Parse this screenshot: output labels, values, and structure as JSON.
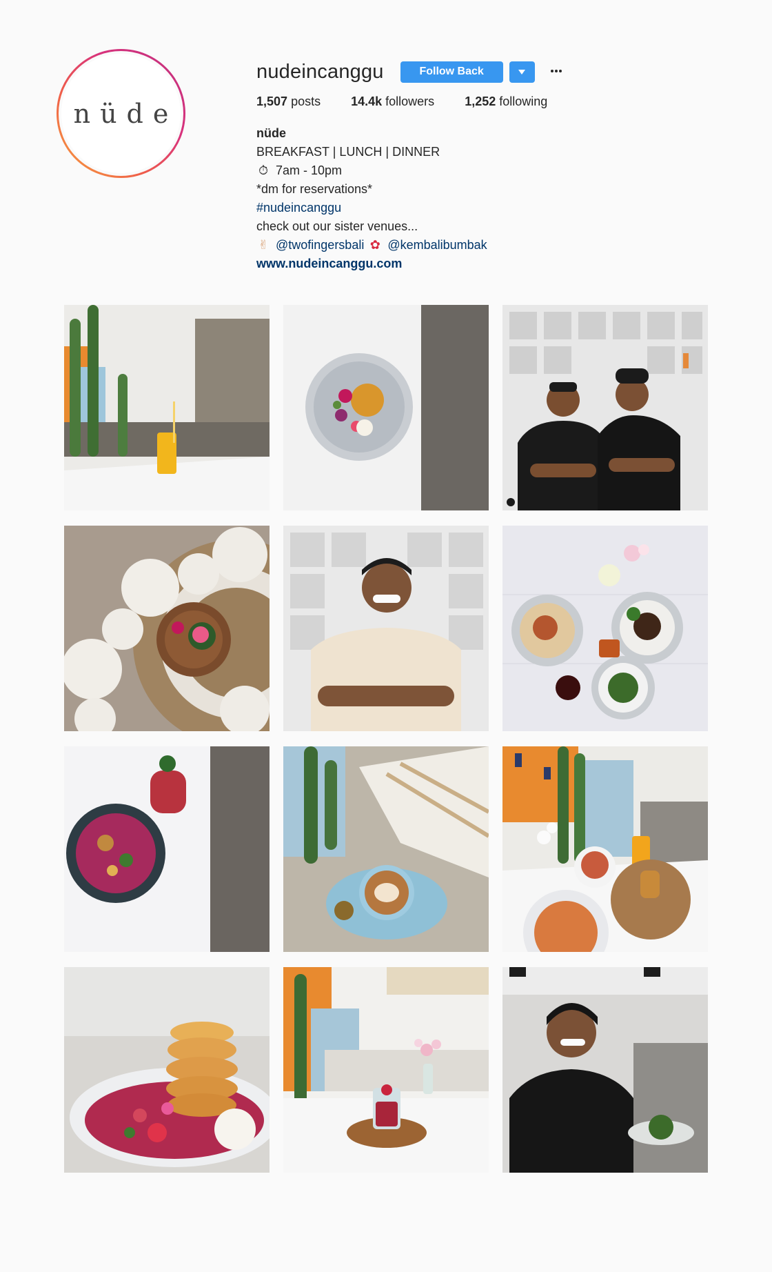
{
  "profile": {
    "avatar_logo": "nüde",
    "username": "nudeincanggu",
    "follow_back_label": "Follow Back",
    "more_icon": "more-horizontal-icon",
    "dropdown_icon": "caret-down-icon",
    "ring_colors": [
      "#f7a43c",
      "#ef5d4a",
      "#d8327c",
      "#c0307e"
    ],
    "accent_color": "#3897f0"
  },
  "stats": {
    "posts_count": "1,507",
    "posts_label": "posts",
    "followers_count": "14.4k",
    "followers_label": "followers",
    "following_count": "1,252",
    "following_label": "following"
  },
  "bio": {
    "name": "nüde",
    "line1": "BREAKFAST | LUNCH | DINNER",
    "hours_emoji": "⏱",
    "hours": "7am - 10pm",
    "line3": "*dm for reservations*",
    "hashtag": "#nudeincanggu",
    "line5": "check out our sister venues...",
    "peace_emoji": "✌",
    "mention1": "@twofingersbali",
    "flower_emoji": "✿",
    "mention2": "@kembalibumbak",
    "website": "www.nudeincanggu.com"
  },
  "posts": [
    {
      "subject": "mango smoothie by cactus"
    },
    {
      "subject": "pancake plate with flowers"
    },
    {
      "subject": "two staff members arms crossed"
    },
    {
      "subject": "woven placemats with bowl"
    },
    {
      "subject": "smiling man arms crossed"
    },
    {
      "subject": "table spread with dishes"
    },
    {
      "subject": "acai bowl and drink"
    },
    {
      "subject": "latte art coffee"
    },
    {
      "subject": "breakfast table with juice"
    },
    {
      "subject": "pancake stack with fruit"
    },
    {
      "subject": "dessert glass with flowers"
    },
    {
      "subject": "waiter holding a dish"
    }
  ]
}
